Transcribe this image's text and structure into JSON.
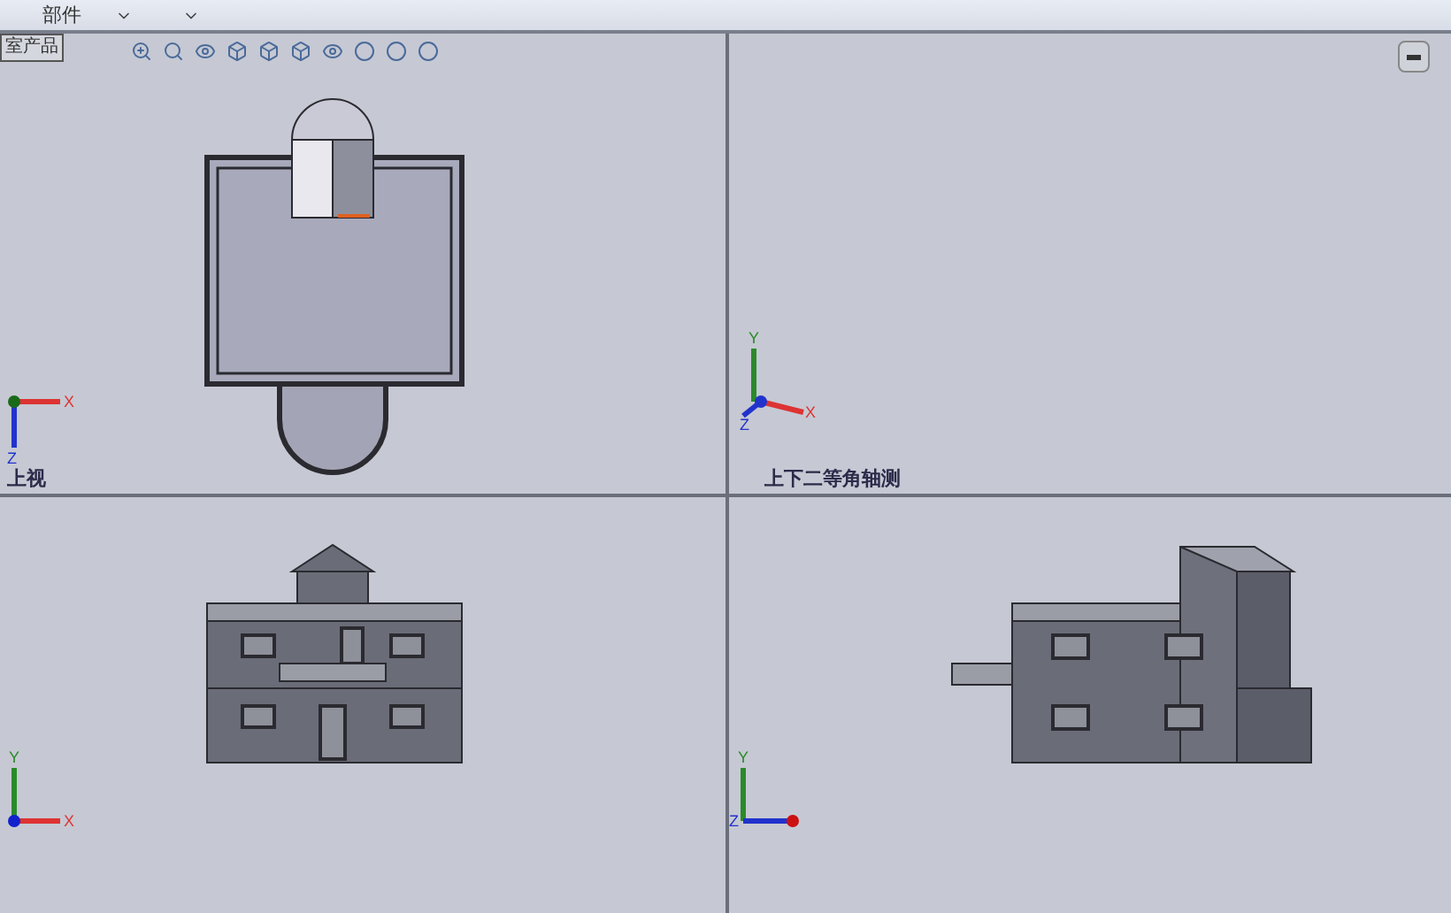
{
  "ribbon": {
    "items": [
      {
        "label": "部件"
      }
    ]
  },
  "document_tab": {
    "label": "室产品"
  },
  "viewports": [
    {
      "kind": "top",
      "label": "上视",
      "axes": [
        {
          "kind": "x",
          "label": "X"
        },
        {
          "kind": "z-down",
          "label": "Z"
        }
      ]
    },
    {
      "kind": "iso",
      "label": "上下二等角轴测",
      "axes": [
        {
          "kind": "y",
          "label": "Y"
        },
        {
          "kind": "x-iso",
          "label": "X"
        },
        {
          "kind": "z-iso",
          "label": "Z"
        }
      ]
    },
    {
      "kind": "front",
      "axes": [
        {
          "kind": "y",
          "label": "Y"
        },
        {
          "kind": "x",
          "label": "X"
        }
      ]
    },
    {
      "kind": "right",
      "axes": [
        {
          "kind": "y",
          "label": "Y"
        },
        {
          "kind": "z-left",
          "label": "Z"
        }
      ]
    }
  ]
}
